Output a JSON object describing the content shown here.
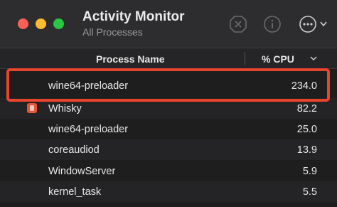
{
  "window": {
    "title": "Activity Monitor",
    "subtitle": "All Processes"
  },
  "toolbar": {
    "icons": [
      "stop-process-icon",
      "info-icon",
      "more-options-icon",
      "chevron-down-icon"
    ]
  },
  "table": {
    "columns": {
      "name": "Process Name",
      "cpu": "% CPU"
    },
    "sort": "descending",
    "rows": [
      {
        "name": "wine64-preloader",
        "cpu": "234.0",
        "icon": "",
        "highlighted": true
      },
      {
        "name": "Whisky",
        "cpu": "82.2",
        "icon": "whisky-app-icon"
      },
      {
        "name": "wine64-preloader",
        "cpu": "25.0",
        "icon": ""
      },
      {
        "name": "coreaudiod",
        "cpu": "13.9",
        "icon": ""
      },
      {
        "name": "WindowServer",
        "cpu": "5.9",
        "icon": ""
      },
      {
        "name": "kernel_task",
        "cpu": "5.5",
        "icon": ""
      }
    ]
  },
  "colors": {
    "highlight_border": "#e8452c",
    "traffic_close": "#fe5f57",
    "traffic_minimize": "#febc2e",
    "traffic_maximize": "#28c840"
  }
}
